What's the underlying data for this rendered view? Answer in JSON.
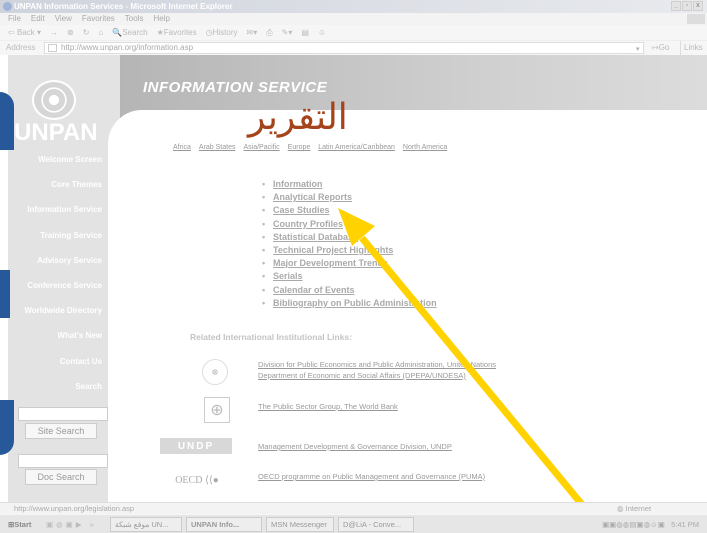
{
  "window": {
    "title": "UNPAN Information Services - Microsoft Internet Explorer",
    "controls": [
      "_",
      "▫",
      "x"
    ]
  },
  "menu": [
    "File",
    "Edit",
    "View",
    "Favorites",
    "Tools",
    "Help"
  ],
  "toolbar": {
    "back": "Back",
    "forward": "→",
    "search": "Search",
    "favorites": "Favorites",
    "history": "History"
  },
  "address": {
    "label": "Address",
    "url": "http://www.unpan.org/information.asp",
    "go": "Go",
    "links": "Links"
  },
  "logo": {
    "text": "UNPAN"
  },
  "header": {
    "title": "INFORMATION SERVICE"
  },
  "nav": [
    "Welcome Screen",
    "Core Themes",
    "Information Service",
    "Training Service",
    "Advisory Service",
    "Conference Service",
    "Worldwide Directory",
    "What's New",
    "Contact Us",
    "Search"
  ],
  "search": {
    "site_button": "Site Search",
    "doc_button": "Doc Search"
  },
  "regions": [
    "Africa",
    "Arab States",
    "Asia/Pacific",
    "Europe",
    "Latin America/Caribbean",
    "North America"
  ],
  "services": [
    "Information",
    "Analytical Reports",
    "Case Studies",
    "Country Profiles",
    "Statistical Database",
    "Technical Project Highlights",
    "Major Development Trends",
    "Serials",
    "Calendar of Events",
    "Bibliography on Public Administration"
  ],
  "related": {
    "heading": "Related International Institutional Links:",
    "links": [
      {
        "line1": "Division for Public Economics and Public Administration, United Nations",
        "line2": "Department of Economic and Social Affairs (DPEPA/UNDESA)"
      },
      {
        "line1": "The Public Sector Group, The World Bank",
        "line2": ""
      },
      {
        "line1": "Management Development & Governance Division, UNDP",
        "line2": ""
      },
      {
        "line1": "OECD programme on Public Management and Governance (PUMA)",
        "line2": ""
      }
    ],
    "logos": {
      "undp": "UNDP",
      "oecd": "OECD"
    }
  },
  "annotation": {
    "text": "التقرير",
    "color": "#a5431a",
    "arrow_color": "#ffd200"
  },
  "status": {
    "url": "http://www.unpan.org/legislation.asp",
    "zone": "Internet"
  },
  "taskbar": {
    "start": "Start",
    "tasks": [
      "موقع شبكة UN...",
      "UNPAN Info...",
      "MSN Messenger",
      "D@LiA - Conve..."
    ],
    "clock": "5:41 PM"
  }
}
